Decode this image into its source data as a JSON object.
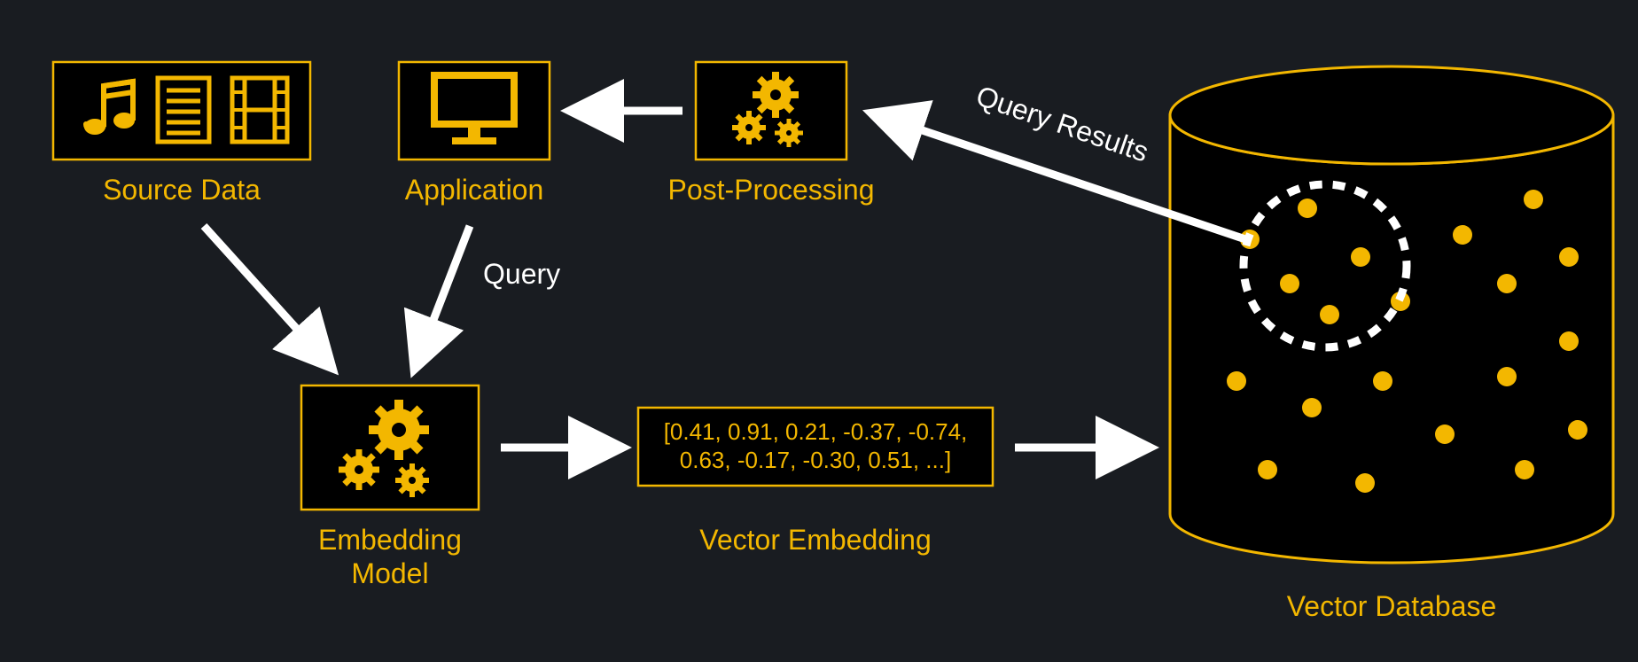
{
  "nodes": {
    "source_data": "Source Data",
    "application": "Application",
    "post_processing": "Post-Processing",
    "embedding_model_line1": "Embedding",
    "embedding_model_line2": "Model",
    "vector_embedding": "Vector Embedding",
    "vector_database": "Vector Database"
  },
  "edges": {
    "query": "Query",
    "query_results": "Query Results"
  },
  "embedding_values_line1": "[0.41, 0.91, 0.21, -0.37, -0.74,",
  "embedding_values_line2": "0.63, -0.17, -0.30, 0.51, ...]"
}
